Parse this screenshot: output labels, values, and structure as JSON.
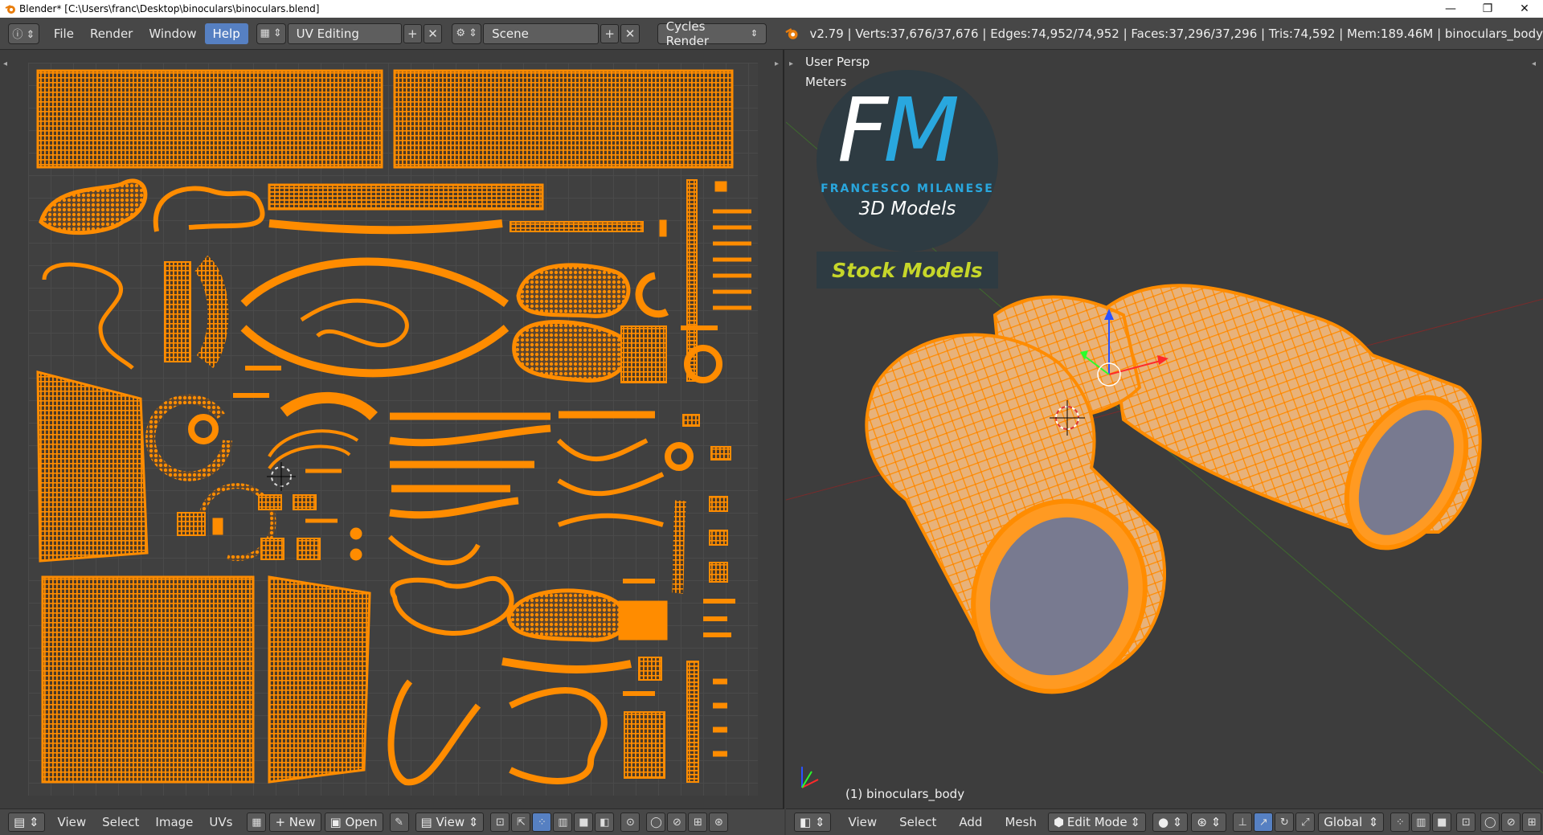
{
  "window": {
    "title": "Blender* [C:\\Users\\franc\\Desktop\\binoculars\\binoculars.blend]",
    "minimize": "—",
    "maximize": "❐",
    "close": "✕"
  },
  "header": {
    "menus": [
      "File",
      "Render",
      "Window",
      "Help"
    ],
    "active_menu": "Help",
    "screen_layout": "UV Editing",
    "scene": "Scene",
    "render_engine": "Cycles Render",
    "stats": "v2.79 | Verts:37,676/37,676 | Edges:74,952/74,952 | Faces:37,296/37,296 | Tris:74,592 | Mem:189.46M | binoculars_body"
  },
  "viewport": {
    "view_name": "User Persp",
    "units": "Meters",
    "object_label": "(1) binoculars_body",
    "logo": {
      "letters_f": "F",
      "letters_m": "M",
      "name": "FRANCESCO MILANESE",
      "subtitle": "3D Models",
      "banner": "Stock Models"
    }
  },
  "uv_footer": {
    "menus": [
      "View",
      "Select",
      "Image",
      "UVs"
    ],
    "new_label": "New",
    "open_label": "Open",
    "view_label": "View"
  },
  "vp_footer": {
    "menus": [
      "View",
      "Select",
      "Add",
      "Mesh"
    ],
    "mode": "Edit Mode",
    "orientation": "Global"
  },
  "colors": {
    "uv_orange": "#ff8c00",
    "selection_blue": "#5680c2",
    "logo_blue": "#29a7de",
    "logo_green": "#c6d62a"
  }
}
